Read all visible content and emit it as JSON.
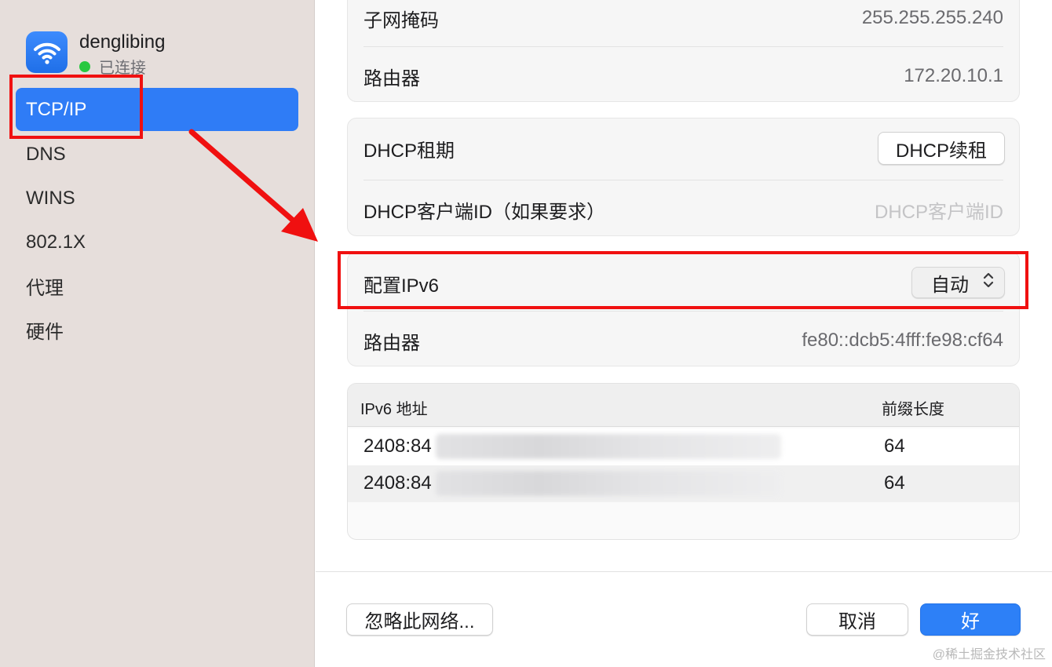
{
  "sidebar": {
    "network_name": "denglibing",
    "network_status": "已连接",
    "items": [
      {
        "label": "TCP/IP",
        "selected": true
      },
      {
        "label": "DNS"
      },
      {
        "label": "WINS"
      },
      {
        "label": "802.1X"
      },
      {
        "label": "代理"
      },
      {
        "label": "硬件"
      }
    ]
  },
  "tcpip": {
    "subnet_mask_label": "子网掩码",
    "subnet_mask_value": "255.255.255.240",
    "router_label": "路由器",
    "router_value": "172.20.10.1",
    "dhcp_lease_label": "DHCP租期",
    "dhcp_renew_button": "DHCP续租",
    "dhcp_client_id_label": "DHCP客户端ID（如果要求）",
    "dhcp_client_id_placeholder": "DHCP客户端ID"
  },
  "ipv6": {
    "configure_label": "配置IPv6",
    "configure_value": "自动",
    "router_label": "路由器",
    "router_value": "fe80::dcb5:4fff:fe98:cf64",
    "table": {
      "headers": [
        "IPv6 地址",
        "前缀长度"
      ],
      "rows": [
        {
          "address": "2408:84",
          "prefix": "64"
        },
        {
          "address": "2408:84",
          "prefix": "64"
        }
      ]
    }
  },
  "footer": {
    "forget_button": "忽略此网络...",
    "cancel_button": "取消",
    "ok_button": "好"
  },
  "watermark": "@稀土掘金技术社区",
  "colors": {
    "accent": "#2f7cf6",
    "annotation": "#f01010",
    "connected": "#28c840"
  }
}
